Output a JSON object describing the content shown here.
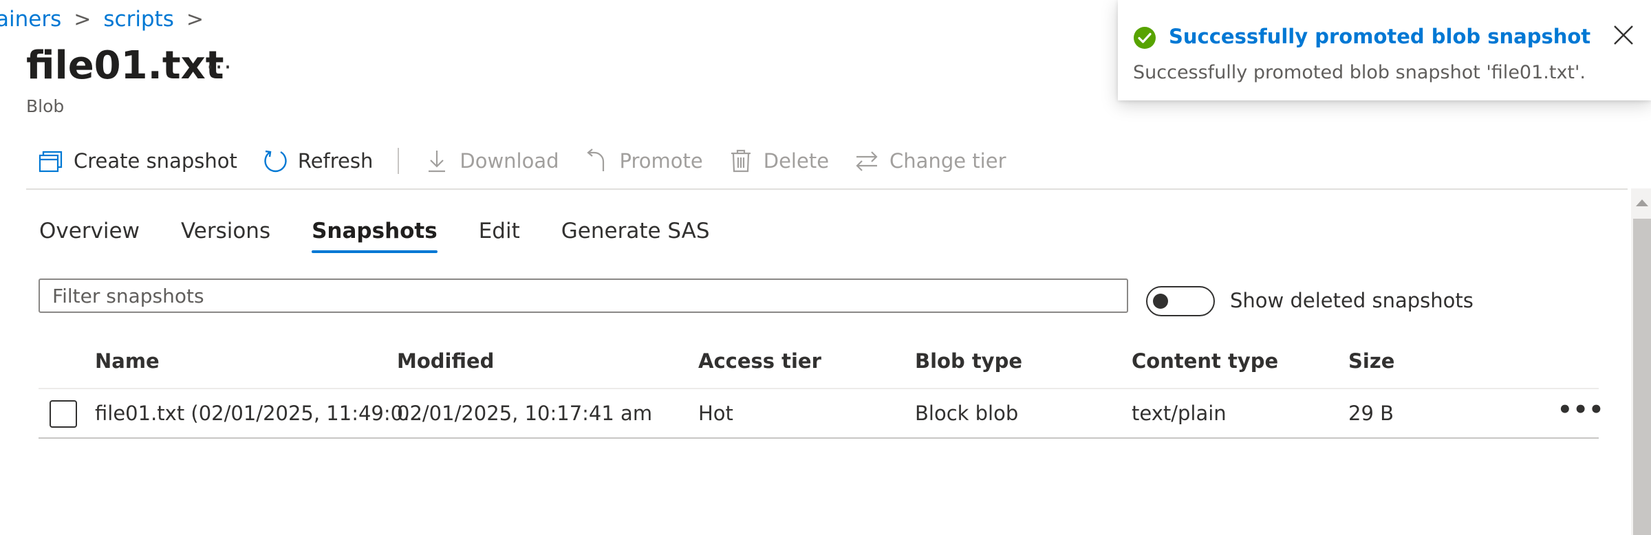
{
  "breadcrumb": {
    "items": [
      {
        "label": "ainers"
      },
      {
        "label": "scripts"
      }
    ],
    "separator": ">"
  },
  "header": {
    "title": "file01.txt",
    "more": "···",
    "subtitle": "Blob"
  },
  "toolbar": {
    "create_snapshot": "Create snapshot",
    "refresh": "Refresh",
    "download": "Download",
    "promote": "Promote",
    "delete": "Delete",
    "change_tier": "Change tier"
  },
  "tabs": [
    {
      "label": "Overview",
      "active": false
    },
    {
      "label": "Versions",
      "active": false
    },
    {
      "label": "Snapshots",
      "active": true
    },
    {
      "label": "Edit",
      "active": false
    },
    {
      "label": "Generate SAS",
      "active": false
    }
  ],
  "filter": {
    "placeholder": "Filter snapshots",
    "value": ""
  },
  "show_deleted": {
    "label": "Show deleted snapshots",
    "on": false
  },
  "table": {
    "columns": [
      "Name",
      "Modified",
      "Access tier",
      "Blob type",
      "Content type",
      "Size"
    ],
    "rows": [
      {
        "name": "file01.txt (02/01/2025, 11:49:0...",
        "modified": "02/01/2025, 10:17:41 am",
        "access_tier": "Hot",
        "blob_type": "Block blob",
        "content_type": "text/plain",
        "size": "29 B",
        "more": "•••"
      }
    ]
  },
  "toast": {
    "title": "Successfully promoted blob snapshot",
    "message": "Successfully promoted blob snapshot 'file01.txt'."
  },
  "colors": {
    "accent": "#0078d4",
    "success": "#57a300",
    "text": "#323130",
    "disabled": "#a19f9d"
  },
  "icons": {
    "create_snapshot": "snapshot-stack-icon",
    "refresh": "refresh-icon",
    "download": "download-icon",
    "promote": "promote-icon",
    "delete": "trash-icon",
    "change_tier": "swap-arrows-icon",
    "toast_status": "success-check-icon",
    "toast_close": "close-icon"
  }
}
